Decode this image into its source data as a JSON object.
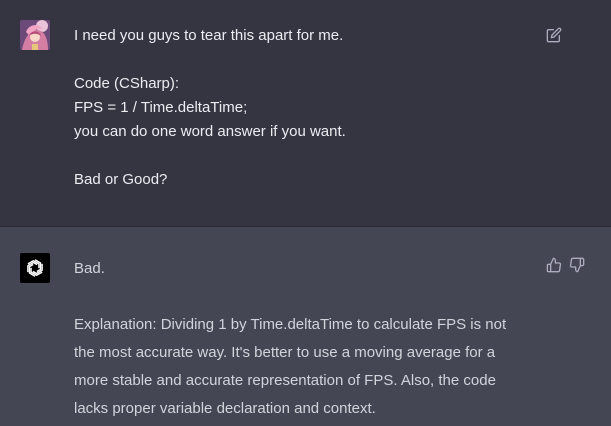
{
  "conversation": {
    "user_message": {
      "text": "I need you guys to tear this apart for me.\n\nCode (CSharp):\nFPS = 1 / Time.deltaTime;\nyou can do one word answer if you want.\n\nBad or Good?"
    },
    "assistant_message": {
      "text": "Bad.\n\nExplanation: Dividing 1 by Time.deltaTime to calculate FPS is not\nthe most accurate way. It's better to use a moving average for a\nmore stable and accurate representation of FPS. Also, the code\nlacks proper variable declaration and context."
    }
  },
  "icons": {
    "user_avatar": "user-avatar-image",
    "assistant_avatar": "openai-logo-icon",
    "edit": "edit-icon",
    "thumbs_up": "thumbs-up-icon",
    "thumbs_down": "thumbs-down-icon"
  },
  "colors": {
    "user_background": "#343541",
    "assistant_background": "#444654",
    "text": "#ececf1",
    "icon": "#acacbe"
  }
}
